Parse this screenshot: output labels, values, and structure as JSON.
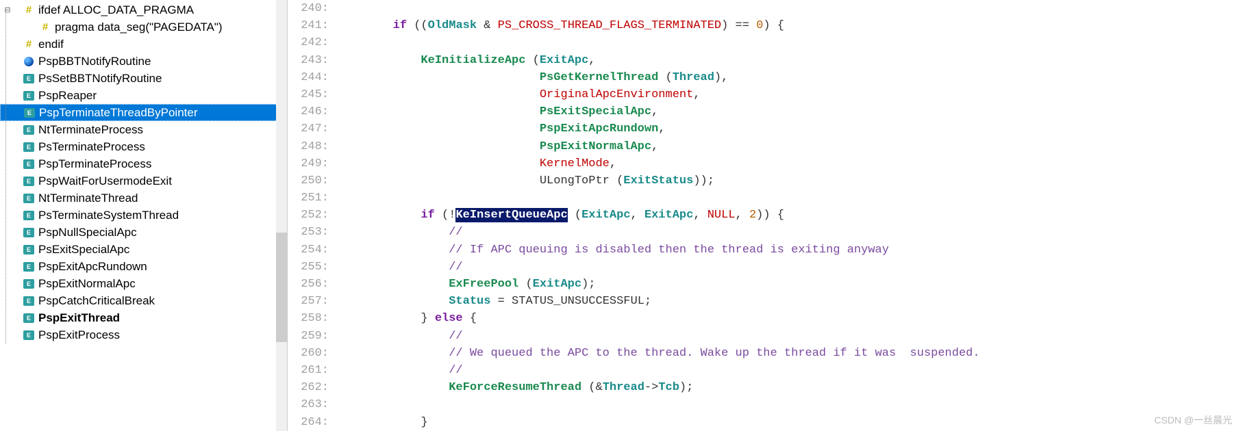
{
  "sidebar": {
    "items": [
      {
        "label": "ifdef ALLOC_DATA_PRAGMA",
        "icon": "hash",
        "expanded": true,
        "indent": 0,
        "bold": false,
        "selected": false
      },
      {
        "label": "pragma data_seg(\"PAGEDATA\")",
        "icon": "hash",
        "indent": 1,
        "bold": false,
        "selected": false
      },
      {
        "label": "endif",
        "icon": "hash",
        "indent": 0,
        "bold": false,
        "selected": false
      },
      {
        "label": "PspBBTNotifyRoutine",
        "icon": "globe",
        "indent": 0,
        "bold": false,
        "selected": false
      },
      {
        "label": "PsSetBBTNotifyRoutine",
        "icon": "func",
        "indent": 0,
        "bold": false,
        "selected": false
      },
      {
        "label": "PspReaper",
        "icon": "func",
        "indent": 0,
        "bold": false,
        "selected": false
      },
      {
        "label": "PspTerminateThreadByPointer",
        "icon": "func",
        "indent": 0,
        "bold": false,
        "selected": true
      },
      {
        "label": "NtTerminateProcess",
        "icon": "func",
        "indent": 0,
        "bold": false,
        "selected": false
      },
      {
        "label": "PsTerminateProcess",
        "icon": "func",
        "indent": 0,
        "bold": false,
        "selected": false
      },
      {
        "label": "PspTerminateProcess",
        "icon": "func",
        "indent": 0,
        "bold": false,
        "selected": false
      },
      {
        "label": "PspWaitForUsermodeExit",
        "icon": "func",
        "indent": 0,
        "bold": false,
        "selected": false
      },
      {
        "label": "NtTerminateThread",
        "icon": "func",
        "indent": 0,
        "bold": false,
        "selected": false
      },
      {
        "label": "PsTerminateSystemThread",
        "icon": "func",
        "indent": 0,
        "bold": false,
        "selected": false
      },
      {
        "label": "PspNullSpecialApc",
        "icon": "func",
        "indent": 0,
        "bold": false,
        "selected": false
      },
      {
        "label": "PsExitSpecialApc",
        "icon": "func",
        "indent": 0,
        "bold": false,
        "selected": false
      },
      {
        "label": "PspExitApcRundown",
        "icon": "func",
        "indent": 0,
        "bold": false,
        "selected": false
      },
      {
        "label": "PspExitNormalApc",
        "icon": "func",
        "indent": 0,
        "bold": false,
        "selected": false
      },
      {
        "label": "PspCatchCriticalBreak",
        "icon": "func",
        "indent": 0,
        "bold": false,
        "selected": false
      },
      {
        "label": "PspExitThread",
        "icon": "func",
        "indent": 0,
        "bold": true,
        "selected": false
      },
      {
        "label": "PspExitProcess",
        "icon": "func",
        "indent": 0,
        "bold": false,
        "selected": false
      }
    ]
  },
  "code": {
    "first_line": 240,
    "lines": [
      {
        "n": 240,
        "segments": []
      },
      {
        "n": 241,
        "segments": [
          {
            "t": "        ",
            "c": "plain"
          },
          {
            "t": "if",
            "c": "kw"
          },
          {
            "t": " ((",
            "c": "op"
          },
          {
            "t": "OldMask",
            "c": "param"
          },
          {
            "t": " & ",
            "c": "op"
          },
          {
            "t": "PS_CROSS_THREAD_FLAGS_TERMINATED",
            "c": "macro"
          },
          {
            "t": ") == ",
            "c": "op"
          },
          {
            "t": "0",
            "c": "num"
          },
          {
            "t": ") {",
            "c": "op"
          }
        ]
      },
      {
        "n": 242,
        "segments": []
      },
      {
        "n": 243,
        "segments": [
          {
            "t": "            ",
            "c": "plain"
          },
          {
            "t": "KeInitializeApc",
            "c": "func"
          },
          {
            "t": " (",
            "c": "op"
          },
          {
            "t": "ExitApc",
            "c": "param"
          },
          {
            "t": ",",
            "c": "op"
          }
        ]
      },
      {
        "n": 244,
        "segments": [
          {
            "t": "                             ",
            "c": "plain"
          },
          {
            "t": "PsGetKernelThread",
            "c": "func"
          },
          {
            "t": " (",
            "c": "op"
          },
          {
            "t": "Thread",
            "c": "param"
          },
          {
            "t": "),",
            "c": "op"
          }
        ]
      },
      {
        "n": 245,
        "segments": [
          {
            "t": "                             ",
            "c": "plain"
          },
          {
            "t": "OriginalApcEnvironment",
            "c": "redname"
          },
          {
            "t": ",",
            "c": "op"
          }
        ]
      },
      {
        "n": 246,
        "segments": [
          {
            "t": "                             ",
            "c": "plain"
          },
          {
            "t": "PsExitSpecialApc",
            "c": "func"
          },
          {
            "t": ",",
            "c": "op"
          }
        ]
      },
      {
        "n": 247,
        "segments": [
          {
            "t": "                             ",
            "c": "plain"
          },
          {
            "t": "PspExitApcRundown",
            "c": "func"
          },
          {
            "t": ",",
            "c": "op"
          }
        ]
      },
      {
        "n": 248,
        "segments": [
          {
            "t": "                             ",
            "c": "plain"
          },
          {
            "t": "PspExitNormalApc",
            "c": "func"
          },
          {
            "t": ",",
            "c": "op"
          }
        ]
      },
      {
        "n": 249,
        "segments": [
          {
            "t": "                             ",
            "c": "plain"
          },
          {
            "t": "KernelMode",
            "c": "redname"
          },
          {
            "t": ",",
            "c": "op"
          }
        ]
      },
      {
        "n": 250,
        "segments": [
          {
            "t": "                             ULongToPtr (",
            "c": "plain"
          },
          {
            "t": "ExitStatus",
            "c": "param"
          },
          {
            "t": "));",
            "c": "op"
          }
        ]
      },
      {
        "n": 251,
        "segments": []
      },
      {
        "n": 252,
        "segments": [
          {
            "t": "            ",
            "c": "plain"
          },
          {
            "t": "if",
            "c": "kw"
          },
          {
            "t": " (!",
            "c": "op"
          },
          {
            "t": "KeInsertQueueApc",
            "c": "sel"
          },
          {
            "t": " (",
            "c": "op"
          },
          {
            "t": "ExitApc",
            "c": "param"
          },
          {
            "t": ", ",
            "c": "op"
          },
          {
            "t": "ExitApc",
            "c": "param"
          },
          {
            "t": ", ",
            "c": "op"
          },
          {
            "t": "NULL",
            "c": "macro"
          },
          {
            "t": ", ",
            "c": "op"
          },
          {
            "t": "2",
            "c": "num"
          },
          {
            "t": ")) {",
            "c": "op"
          }
        ]
      },
      {
        "n": 253,
        "segments": [
          {
            "t": "                ",
            "c": "plain"
          },
          {
            "t": "//",
            "c": "cmt"
          }
        ]
      },
      {
        "n": 254,
        "segments": [
          {
            "t": "                ",
            "c": "plain"
          },
          {
            "t": "// If APC queuing is disabled then the thread is exiting anyway",
            "c": "cmt"
          }
        ]
      },
      {
        "n": 255,
        "segments": [
          {
            "t": "                ",
            "c": "plain"
          },
          {
            "t": "//",
            "c": "cmt"
          }
        ]
      },
      {
        "n": 256,
        "segments": [
          {
            "t": "                ",
            "c": "plain"
          },
          {
            "t": "ExFreePool",
            "c": "func"
          },
          {
            "t": " (",
            "c": "op"
          },
          {
            "t": "ExitApc",
            "c": "param"
          },
          {
            "t": ");",
            "c": "op"
          }
        ]
      },
      {
        "n": 257,
        "segments": [
          {
            "t": "                ",
            "c": "plain"
          },
          {
            "t": "Status",
            "c": "param"
          },
          {
            "t": " = STATUS_UNSUCCESSFUL;",
            "c": "plain"
          }
        ]
      },
      {
        "n": 258,
        "segments": [
          {
            "t": "            } ",
            "c": "op"
          },
          {
            "t": "else",
            "c": "kw"
          },
          {
            "t": " {",
            "c": "op"
          }
        ]
      },
      {
        "n": 259,
        "segments": [
          {
            "t": "                ",
            "c": "plain"
          },
          {
            "t": "//",
            "c": "cmt"
          }
        ]
      },
      {
        "n": 260,
        "segments": [
          {
            "t": "                ",
            "c": "plain"
          },
          {
            "t": "// We queued the APC to the thread. Wake up the thread if it was  suspended.",
            "c": "cmt"
          }
        ]
      },
      {
        "n": 261,
        "segments": [
          {
            "t": "                ",
            "c": "plain"
          },
          {
            "t": "//",
            "c": "cmt"
          }
        ]
      },
      {
        "n": 262,
        "segments": [
          {
            "t": "                ",
            "c": "plain"
          },
          {
            "t": "KeForceResumeThread",
            "c": "func"
          },
          {
            "t": " (&",
            "c": "op"
          },
          {
            "t": "Thread",
            "c": "param"
          },
          {
            "t": "->",
            "c": "op"
          },
          {
            "t": "Tcb",
            "c": "param"
          },
          {
            "t": ");",
            "c": "op"
          }
        ]
      },
      {
        "n": 263,
        "segments": []
      },
      {
        "n": 264,
        "segments": [
          {
            "t": "            ",
            "c": "plain"
          },
          {
            "t": "}",
            "c": "op"
          }
        ]
      }
    ]
  },
  "watermark": "CSDN @一丝晨光"
}
